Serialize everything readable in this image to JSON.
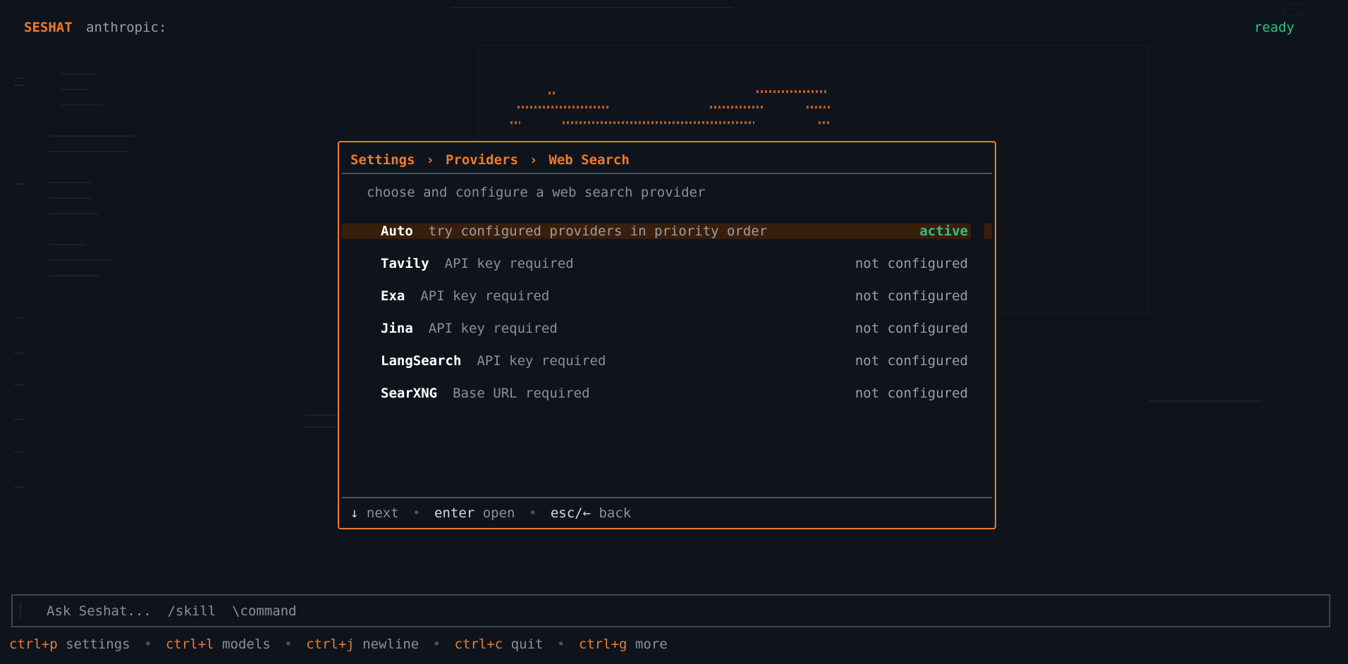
{
  "header": {
    "app_name": "SESHAT",
    "provider": "anthropic:",
    "status": "ready"
  },
  "modal": {
    "breadcrumb": [
      "Settings",
      "Providers",
      "Web Search"
    ],
    "breadcrumb_separator": "›",
    "subtitle": "choose and configure a web search provider",
    "providers": [
      {
        "name": "Auto",
        "description": "try configured providers in priority order",
        "status": "active",
        "selected": true
      },
      {
        "name": "Tavily",
        "description": "API key required",
        "status": "not configured",
        "selected": false
      },
      {
        "name": "Exa",
        "description": "API key required",
        "status": "not configured",
        "selected": false
      },
      {
        "name": "Jina",
        "description": "API key required",
        "status": "not configured",
        "selected": false
      },
      {
        "name": "LangSearch",
        "description": "API key required",
        "status": "not configured",
        "selected": false
      },
      {
        "name": "SearXNG",
        "description": "Base URL required",
        "status": "not configured",
        "selected": false
      }
    ],
    "hints": [
      {
        "key": "↓",
        "action": "next"
      },
      {
        "key": "enter",
        "action": "open"
      },
      {
        "key": "esc/←",
        "action": "back"
      }
    ]
  },
  "input": {
    "placeholder": "Ask Seshat...  /skill  \\command",
    "value": ""
  },
  "footer": {
    "shortcuts": [
      {
        "key": "ctrl+p",
        "action": "settings"
      },
      {
        "key": "ctrl+l",
        "action": "models"
      },
      {
        "key": "ctrl+j",
        "action": "newline"
      },
      {
        "key": "ctrl+c",
        "action": "quit"
      },
      {
        "key": "ctrl+g",
        "action": "more"
      }
    ]
  },
  "colors": {
    "accent": "#f07a2a",
    "success": "#2fc08a",
    "background": "#0f141c",
    "selected_row": "#3a1e0c"
  }
}
